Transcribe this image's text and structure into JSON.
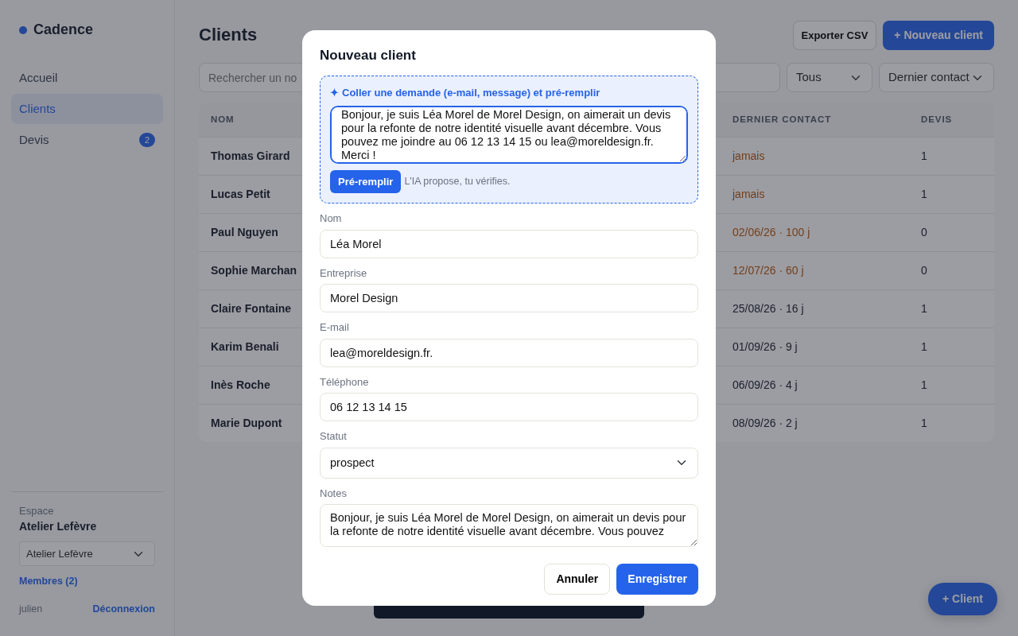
{
  "sidebar": {
    "brand": "Cadence",
    "items": [
      {
        "label": "Accueil",
        "selected": false
      },
      {
        "label": "Clients",
        "selected": true
      },
      {
        "label": "Devis",
        "selected": false,
        "badge": "2"
      }
    ],
    "workspace": {
      "label": "Espace",
      "name": "Atelier Lefèvre",
      "select_value": "Atelier Lefèvre",
      "members_link": "Membres (2)",
      "user": "julien",
      "logout": "Déconnexion"
    }
  },
  "page": {
    "title": "Clients",
    "export_button": "Exporter CSV",
    "new_button": "+ Nouveau client",
    "search": {
      "placeholder": "Rechercher un no"
    },
    "filter": "Tous",
    "sort": "Dernier contact"
  },
  "table": {
    "columns": [
      "NOM",
      "DERNIER CONTACT",
      "DEVIS"
    ],
    "rows": [
      {
        "name": "Thomas Girard",
        "last_contact": "jamais",
        "overdue": true,
        "quotes": "1"
      },
      {
        "name": "Lucas Petit",
        "last_contact": "jamais",
        "overdue": true,
        "quotes": "1"
      },
      {
        "name": "Paul Nguyen",
        "last_contact": "02/06/26 · 100 j",
        "overdue": true,
        "quotes": "0"
      },
      {
        "name": "Sophie Marchan",
        "last_contact": "12/07/26 · 60 j",
        "overdue": true,
        "quotes": "0"
      },
      {
        "name": "Claire Fontaine",
        "last_contact": "25/08/26 · 16 j",
        "overdue": false,
        "quotes": "1"
      },
      {
        "name": "Karim Benali",
        "last_contact": "01/09/26 · 9 j",
        "overdue": false,
        "quotes": "1"
      },
      {
        "name": "Inès Roche",
        "last_contact": "06/09/26 · 4 j",
        "overdue": false,
        "quotes": "1"
      },
      {
        "name": "Marie Dupont",
        "last_contact": "08/09/26 · 2 j",
        "overdue": false,
        "quotes": "1"
      }
    ]
  },
  "modal": {
    "title": "Nouveau client",
    "ai": {
      "icon": "✦",
      "heading": "Coller une demande (e-mail, message) et pré-remplir",
      "text": "Bonjour, je suis Léa Morel de Morel Design, on aimerait un devis pour la refonte de notre identité visuelle avant décembre. Vous pouvez me joindre au 06 12 13 14 15 ou lea@moreldesign.fr. Merci !",
      "button": "Pré-remplir",
      "hint": "L'IA propose, tu vérifies."
    },
    "fields": [
      {
        "label": "Nom",
        "value": "Léa Morel",
        "kind": "text"
      },
      {
        "label": "Entreprise",
        "value": "Morel Design",
        "kind": "text"
      },
      {
        "label": "E-mail",
        "value": "lea@moreldesign.fr.",
        "kind": "text"
      },
      {
        "label": "Téléphone",
        "value": "06 12 13 14 15",
        "kind": "text"
      },
      {
        "label": "Statut",
        "value": "prospect",
        "kind": "select"
      },
      {
        "label": "Notes",
        "value": "Bonjour, je suis Léa Morel de Morel Design, on aimerait un devis pour la refonte de notre identité visuelle avant décembre. Vous pouvez",
        "kind": "textarea"
      }
    ],
    "buttons": [
      {
        "label": "Annuler",
        "kind": "secondary"
      },
      {
        "label": "Enregistrer",
        "kind": "primary"
      }
    ]
  },
  "fab": "+ Client"
}
